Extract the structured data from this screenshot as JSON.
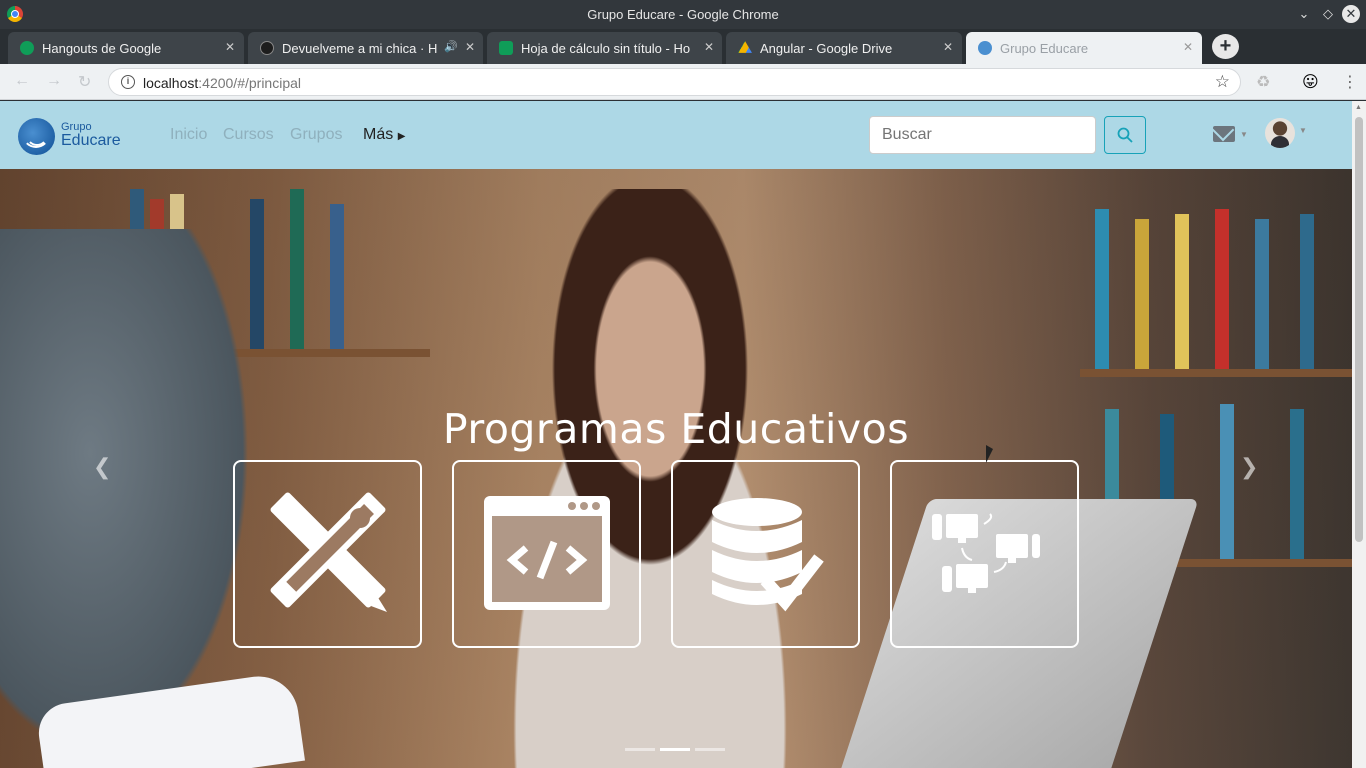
{
  "window": {
    "title": "Grupo Educare - Google Chrome"
  },
  "tabs": [
    {
      "label": "Hangouts de Google",
      "color": "#0f9d58"
    },
    {
      "label": "Devuelveme a mi chica · H",
      "color": "#1d1d1d"
    },
    {
      "label": "Hoja de cálculo sin título - Ho",
      "color": "#0f9d58"
    },
    {
      "label": "Angular - Google Drive",
      "color": "#f4b400"
    },
    {
      "label": "Grupo Educare",
      "color": "#4a8fd0"
    }
  ],
  "omnibox": {
    "host": "localhost",
    "path": ":4200/#/principal"
  },
  "site": {
    "logo_small": "Grupo",
    "logo_big": "Educare",
    "nav": [
      "Inicio",
      "Cursos",
      "Grupos",
      "Más"
    ],
    "search_placeholder": "Buscar",
    "accent": "#add8e6"
  },
  "hero": {
    "title": "Programas Educativos",
    "cards": [
      {
        "icon": "design-tools-icon"
      },
      {
        "icon": "code-window-icon"
      },
      {
        "icon": "database-check-icon"
      },
      {
        "icon": "network-devices-icon"
      }
    ],
    "slides": 3,
    "active_slide": 2
  }
}
